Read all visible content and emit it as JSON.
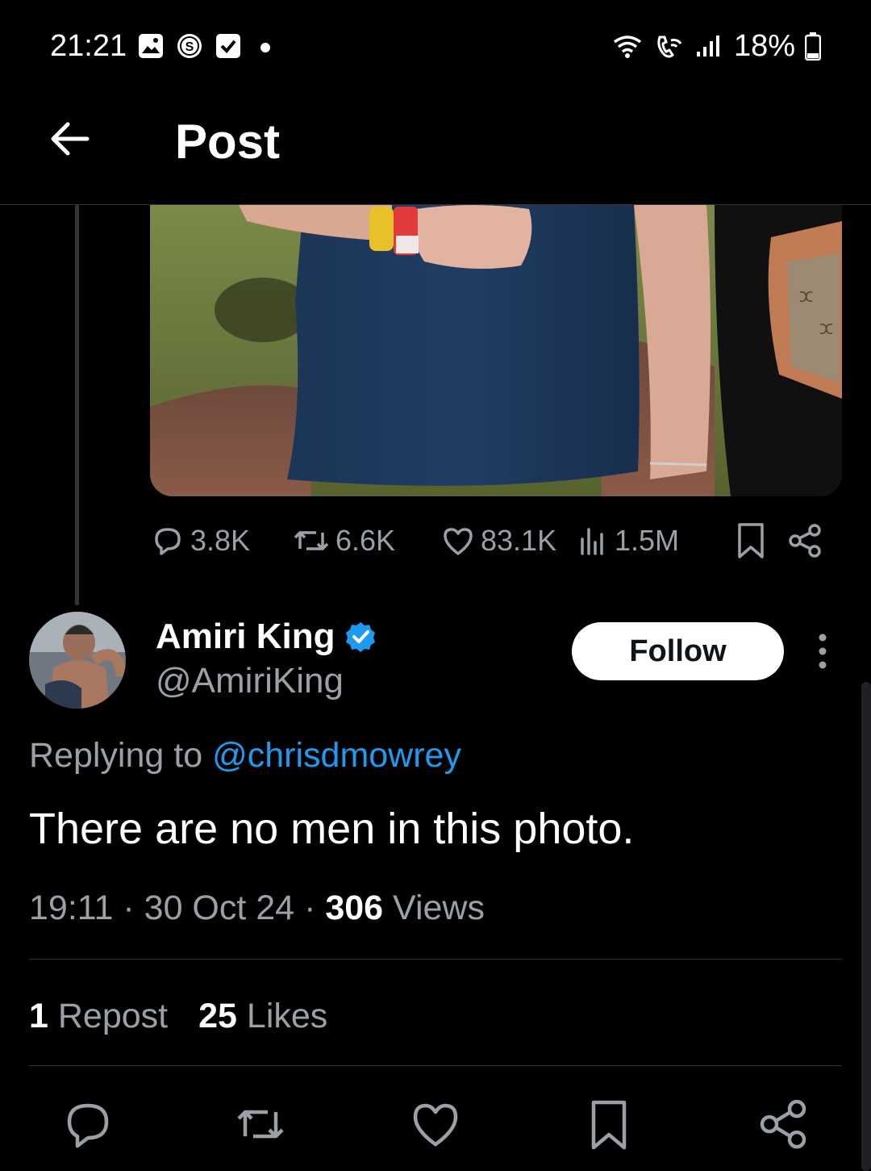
{
  "status_bar": {
    "time": "21:21",
    "battery": "18%",
    "icons": [
      "gallery-icon",
      "s-app-icon",
      "check-icon",
      "dot-icon",
      "wifi-icon",
      "wifi-call-icon",
      "signal-icon",
      "battery-icon"
    ]
  },
  "header": {
    "title": "Post",
    "back_icon": "arrow-left-icon"
  },
  "parent_post": {
    "stats": {
      "replies": "3.8K",
      "reposts": "6.6K",
      "likes": "83.1K",
      "views": "1.5M"
    }
  },
  "reply": {
    "author_name": "Amiri King",
    "author_handle": "@AmiriKing",
    "verified": true,
    "follow_label": "Follow",
    "replying_prefix": "Replying to",
    "replying_to": "@chrisdmowrey",
    "text": "There are no men in this photo.",
    "time": "19:11",
    "date": "30 Oct 24",
    "views_count": "306",
    "views_label": "Views",
    "reposts_count": "1",
    "reposts_label": "Repost",
    "likes_count": "25",
    "likes_label": "Likes"
  },
  "colors": {
    "background": "#000000",
    "accent": "#1d9bf0",
    "muted_text": "#9aa0a6",
    "divider": "#2f3336"
  }
}
